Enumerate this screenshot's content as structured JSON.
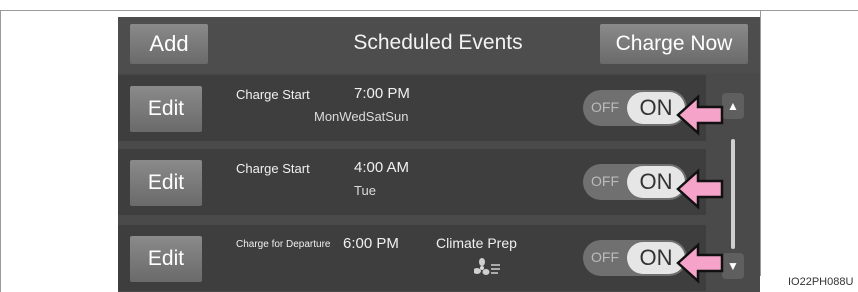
{
  "header": {
    "add_label": "Add",
    "title": "Scheduled Events",
    "charge_now_label": "Charge Now"
  },
  "events": [
    {
      "edit_label": "Edit",
      "type": "Charge Start",
      "time": "7:00 PM",
      "days": "MonWedSatSun",
      "off_label": "OFF",
      "on_label": "ON"
    },
    {
      "edit_label": "Edit",
      "type": "Charge Start",
      "time": "4:00 AM",
      "days": "Tue",
      "off_label": "OFF",
      "on_label": "ON"
    },
    {
      "edit_label": "Edit",
      "type": "Charge for Departure",
      "time": "6:00 PM",
      "extra": "Climate Prep",
      "extra_icon": "climate-fan-icon",
      "off_label": "OFF",
      "on_label": "ON"
    }
  ],
  "reference_code": "IO22PH088U",
  "colors": {
    "arrow_fill": "#f5a3c8",
    "screen_bg": "#4a4a4a",
    "button_bg": "#7a7a7a"
  }
}
